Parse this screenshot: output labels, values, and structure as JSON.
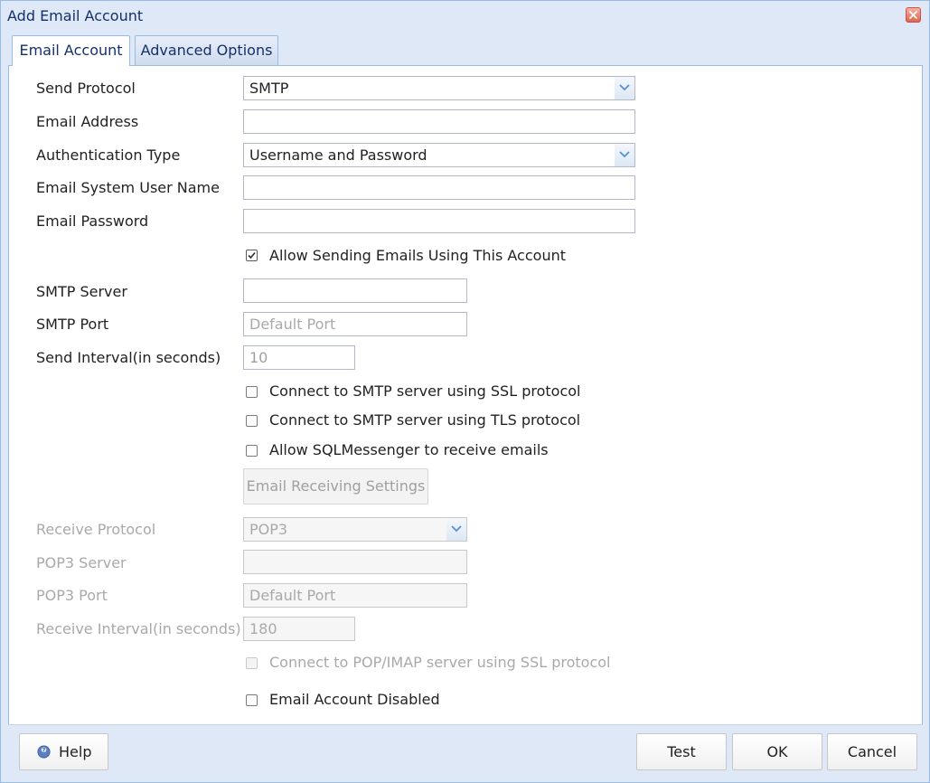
{
  "window": {
    "title": "Add Email Account"
  },
  "tabs": [
    {
      "label": "Email Account",
      "active": true
    },
    {
      "label": "Advanced Options",
      "active": false
    }
  ],
  "form": {
    "send_protocol": {
      "label": "Send Protocol",
      "value": "SMTP"
    },
    "email_address": {
      "label": "Email Address",
      "value": ""
    },
    "auth_type": {
      "label": "Authentication Type",
      "value": "Username and Password"
    },
    "user_name": {
      "label": "Email System User Name",
      "value": ""
    },
    "password": {
      "label": "Email Password",
      "value": ""
    },
    "allow_sending": {
      "label": "Allow Sending Emails Using This Account",
      "checked": true
    },
    "smtp_server": {
      "label": "SMTP Server",
      "value": ""
    },
    "smtp_port": {
      "label": "SMTP Port",
      "placeholder": "Default Port"
    },
    "send_interval": {
      "label": "Send Interval(in seconds)",
      "value": "10"
    },
    "smtp_ssl": {
      "label": "Connect to SMTP server using SSL protocol",
      "checked": false
    },
    "smtp_tls": {
      "label": "Connect to SMTP server using TLS protocol",
      "checked": false
    },
    "allow_receive": {
      "label": "Allow SQLMessenger to receive emails",
      "checked": false
    },
    "receiving_settings_button": "Email Receiving Settings",
    "receive_protocol": {
      "label": "Receive Protocol",
      "value": "POP3"
    },
    "pop3_server": {
      "label": "POP3 Server",
      "value": ""
    },
    "pop3_port": {
      "label": "POP3 Port",
      "placeholder": "Default Port"
    },
    "receive_interval": {
      "label": "Receive Interval(in seconds)",
      "value": "180"
    },
    "pop_ssl": {
      "label": "Connect to POP/IMAP server using SSL protocol",
      "checked": false
    },
    "account_disabled": {
      "label": "Email Account Disabled",
      "checked": false
    }
  },
  "footer": {
    "help": "Help",
    "test": "Test",
    "ok": "OK",
    "cancel": "Cancel"
  },
  "colors": {
    "frame_bg": "#dfe8f6",
    "frame_border": "#99bbe8",
    "title_text": "#15306b",
    "disabled_text": "#a9a9a9",
    "close_button": "#e0624f",
    "help_icon": "#5b7fbf"
  },
  "icons": {
    "close": "close-icon",
    "dropdown": "chevron-down-icon",
    "check": "check-icon",
    "help": "help-icon"
  }
}
